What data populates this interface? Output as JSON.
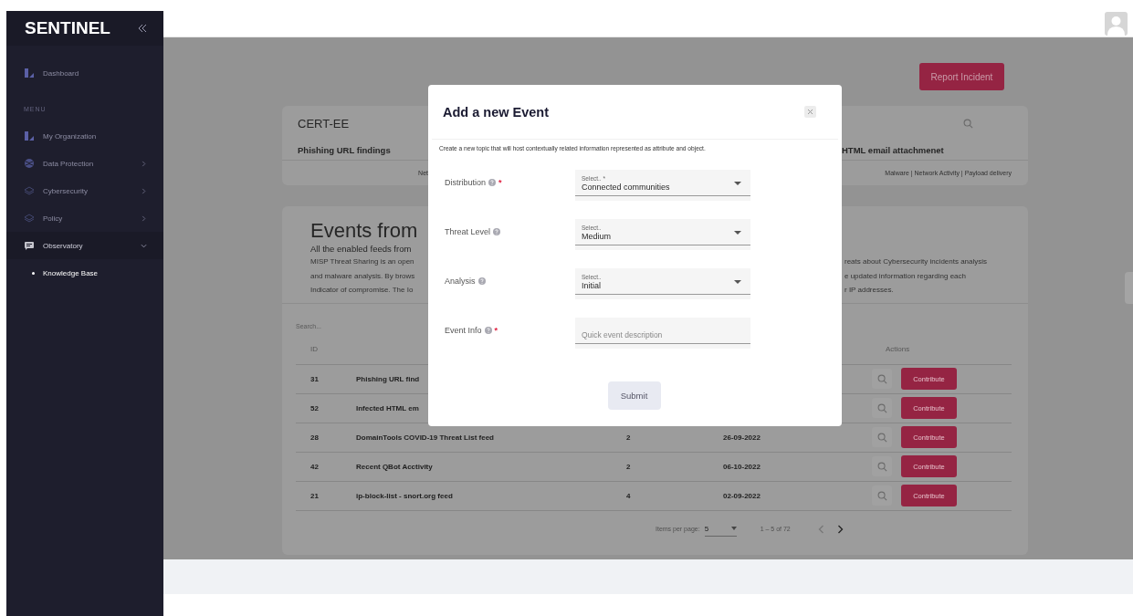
{
  "sidebar": {
    "logo": "SENTINEL",
    "items": [
      {
        "kind": "link",
        "label": "Dashboard",
        "selected": false
      },
      {
        "kind": "section",
        "label": "MENU"
      },
      {
        "kind": "link",
        "label": "My Organization",
        "selected": false
      },
      {
        "kind": "group",
        "label": "Data Protection",
        "selected": false,
        "expanded": false
      },
      {
        "kind": "group",
        "label": "Cybersecurity",
        "selected": false,
        "expanded": false
      },
      {
        "kind": "group",
        "label": "Policy",
        "selected": false,
        "expanded": false
      },
      {
        "kind": "group",
        "label": "Observatory",
        "selected": false,
        "expanded": true,
        "children": [
          {
            "label": "Knowledge Base",
            "selected": true
          }
        ]
      }
    ]
  },
  "header": {
    "report_button": "Report Incident"
  },
  "feed_card": {
    "org": "CERT-EE",
    "feeds": [
      {
        "title": "Phishing URL findings",
        "tags": "Net"
      },
      {
        "title": "HTML email attachmenet",
        "tags": "Malware | Network Activity | Payload delivery"
      }
    ]
  },
  "events": {
    "title": "Events from",
    "subtitle": "All the enabled feeds from",
    "description_left": [
      "MISP Threat Sharing is an open",
      "and malware analysis. By brows",
      "Indicator of compromise. The Io"
    ],
    "description_right": [
      "reats about Cybersecurity incidents analysis",
      "e updated information regarding each",
      "r IP addresses."
    ],
    "search": {
      "placeholder": "Search..."
    },
    "table": {
      "id_header": "ID",
      "actions_header": "Actions",
      "rows": [
        {
          "id": "31",
          "title": "Phishing URL find",
          "action": "Contribute"
        },
        {
          "id": "52",
          "title": "Infected HTML em",
          "action": "Contribute"
        },
        {
          "id": "28",
          "title": "DomainTools COVID-19 Threat List feed",
          "count": "2",
          "date": "26-09-2022",
          "action": "Contribute"
        },
        {
          "id": "42",
          "title": "Recent QBot Acctivity",
          "count": "2",
          "date": "06-10-2022",
          "action": "Contribute"
        },
        {
          "id": "21",
          "title": "ip-block-list - snort.org feed",
          "count": "4",
          "date": "02-09-2022",
          "action": "Contribute"
        }
      ]
    },
    "pagination": {
      "label": "Items per page:",
      "page_size": "5",
      "range": "1 – 5 of 72",
      "prev_disabled": true,
      "next_disabled": false
    }
  },
  "modal": {
    "title": "Add a new Event",
    "description": "Create a new topic that will host contextually related information represented as attribute and object.",
    "fields": [
      {
        "kind": "select",
        "label": "Distribution",
        "required_mark": "*",
        "float_label": "Select.. *",
        "value": "Connected communities"
      },
      {
        "kind": "select",
        "label": "Threat Level",
        "float_label": "Select..",
        "value": "Medium"
      },
      {
        "kind": "select",
        "label": "Analysis",
        "float_label": "Select..",
        "value": "Initial"
      },
      {
        "kind": "text",
        "label": "Event Info",
        "required_mark": "*",
        "placeholder": "Quick event description"
      }
    ],
    "submit": "Submit"
  }
}
